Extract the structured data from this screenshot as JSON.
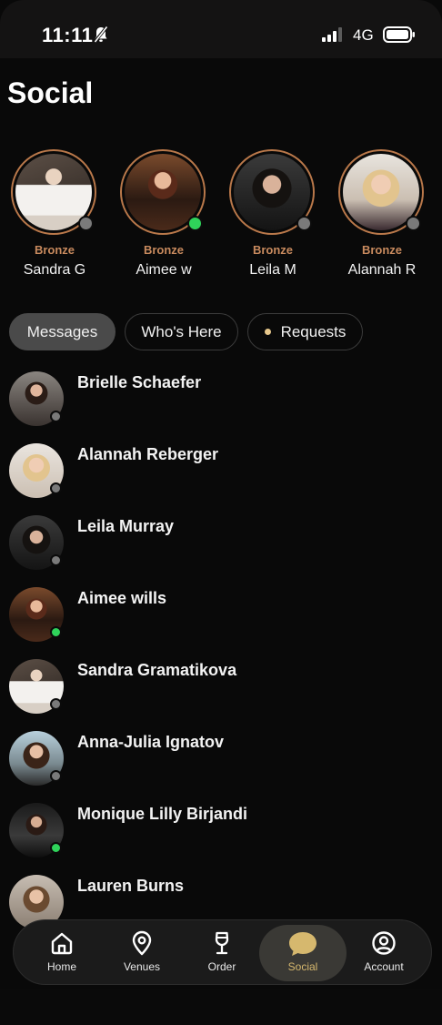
{
  "status_bar": {
    "time": "11:11",
    "network": "4G"
  },
  "page": {
    "title": "Social"
  },
  "stories": [
    {
      "tier": "Bronze",
      "name": "Sandra G",
      "online": false
    },
    {
      "tier": "Bronze",
      "name": "Aimee w",
      "online": true
    },
    {
      "tier": "Bronze",
      "name": "Leila M",
      "online": false
    },
    {
      "tier": "Bronze",
      "name": "Alannah R",
      "online": false
    }
  ],
  "tabs": [
    {
      "label": "Messages",
      "active": true
    },
    {
      "label": "Who's Here",
      "active": false
    },
    {
      "label": "Requests",
      "active": false,
      "has_indicator": true
    }
  ],
  "messages": [
    {
      "name": "Brielle Schaefer",
      "online": false
    },
    {
      "name": "Alannah Reberger",
      "online": false
    },
    {
      "name": "Leila Murray",
      "online": false
    },
    {
      "name": "Aimee wills",
      "online": true
    },
    {
      "name": "Sandra Gramatikova",
      "online": false
    },
    {
      "name": "Anna-Julia Ignatov",
      "online": false
    },
    {
      "name": "Monique Lilly Birjandi",
      "online": true
    },
    {
      "name": "Lauren Burns",
      "online": false
    }
  ],
  "nav": [
    {
      "label": "Home",
      "icon": "home-icon"
    },
    {
      "label": "Venues",
      "icon": "location-pin-icon"
    },
    {
      "label": "Order",
      "icon": "wine-glass-icon"
    },
    {
      "label": "Social",
      "icon": "chat-bubble-icon",
      "active": true
    },
    {
      "label": "Account",
      "icon": "account-icon"
    }
  ],
  "colors": {
    "online": "#2fd35a",
    "offline": "#7a7a7a",
    "tier_bronze": "#c88a5e",
    "accent_gold": "#d6b86e"
  }
}
